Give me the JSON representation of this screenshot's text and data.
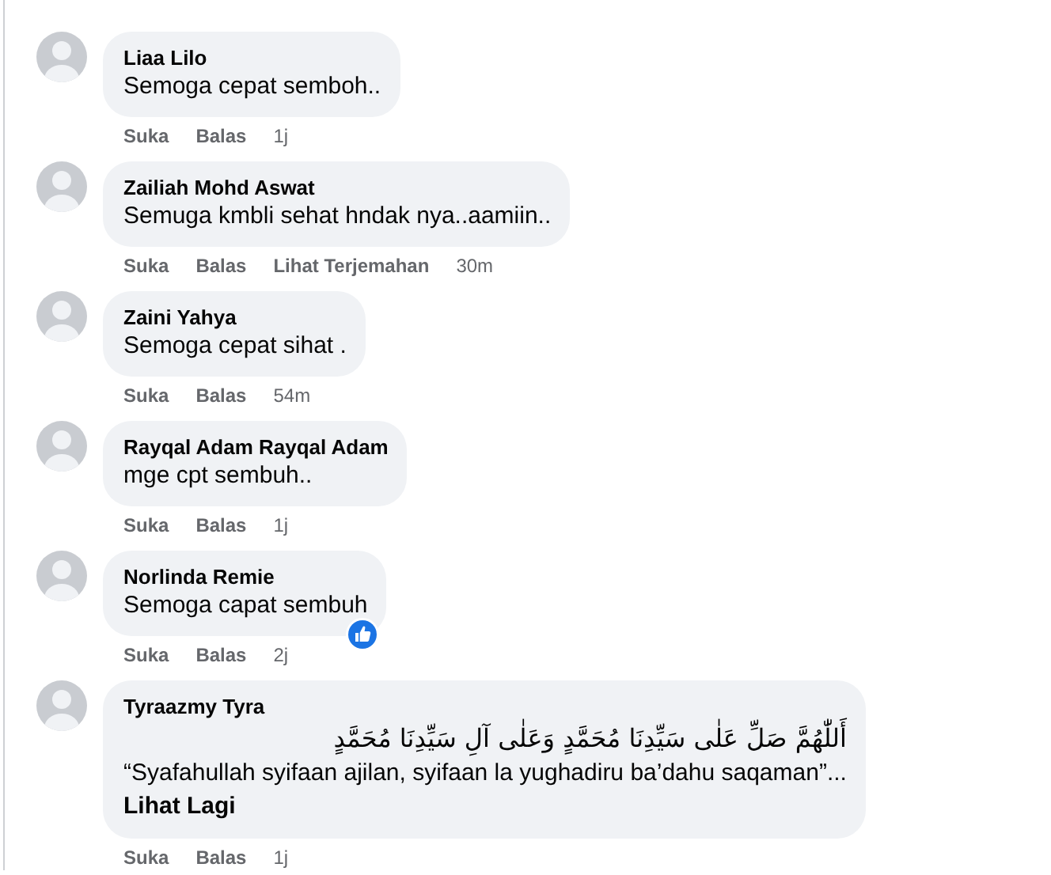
{
  "comments": [
    {
      "author": "Liaa Lilo",
      "text": "Semoga cepat semboh..",
      "liked": false,
      "actions": [
        "Suka",
        "Balas"
      ],
      "time": "1j"
    },
    {
      "author": "Zailiah Mohd Aswat",
      "text": "Semuga kmbli sehat hndak nya..aamiin..",
      "liked": false,
      "actions": [
        "Suka",
        "Balas",
        "Lihat Terjemahan"
      ],
      "time": "30m"
    },
    {
      "author": "Zaini Yahya",
      "text": "Semoga cepat sihat .",
      "liked": false,
      "actions": [
        "Suka",
        "Balas"
      ],
      "time": "54m"
    },
    {
      "author": "Rayqal Adam Rayqal Adam",
      "text": "mge cpt sembuh..",
      "liked": false,
      "actions": [
        "Suka",
        "Balas"
      ],
      "time": "1j"
    },
    {
      "author": "Norlinda Remie",
      "text": "Semoga capat sembuh",
      "liked": true,
      "actions": [
        "Suka",
        "Balas"
      ],
      "time": "2j"
    },
    {
      "author": "Tyraazmy Tyra",
      "arabic": "أَللّٰهُمَّ صَلِّ عَلٰى سَيِّدِنَا مُحَمَّدٍ وَعَلٰى آلِ سَيِّدِنَا مُحَمَّدٍ",
      "text": "“Syafahullah syifaan ajilan, syifaan la yughadiru ba’dahu saqaman”...",
      "see_more": "Lihat Lagi",
      "liked": false,
      "actions": [
        "Suka",
        "Balas"
      ],
      "time": "1j"
    }
  ]
}
